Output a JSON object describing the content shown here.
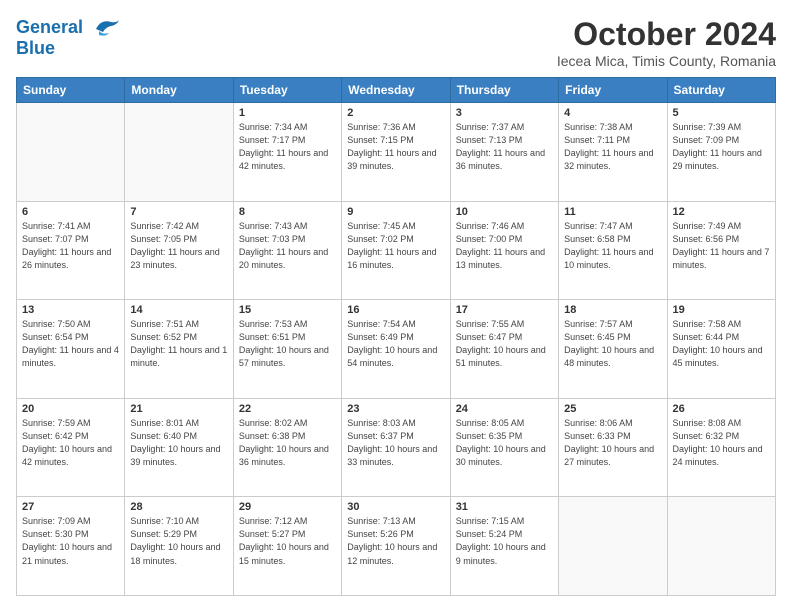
{
  "header": {
    "logo_line1": "General",
    "logo_line2": "Blue",
    "main_title": "October 2024",
    "subtitle": "Iecea Mica, Timis County, Romania"
  },
  "days_of_week": [
    "Sunday",
    "Monday",
    "Tuesday",
    "Wednesday",
    "Thursday",
    "Friday",
    "Saturday"
  ],
  "weeks": [
    [
      {
        "day": "",
        "detail": ""
      },
      {
        "day": "",
        "detail": ""
      },
      {
        "day": "1",
        "detail": "Sunrise: 7:34 AM\nSunset: 7:17 PM\nDaylight: 11 hours and 42 minutes."
      },
      {
        "day": "2",
        "detail": "Sunrise: 7:36 AM\nSunset: 7:15 PM\nDaylight: 11 hours and 39 minutes."
      },
      {
        "day": "3",
        "detail": "Sunrise: 7:37 AM\nSunset: 7:13 PM\nDaylight: 11 hours and 36 minutes."
      },
      {
        "day": "4",
        "detail": "Sunrise: 7:38 AM\nSunset: 7:11 PM\nDaylight: 11 hours and 32 minutes."
      },
      {
        "day": "5",
        "detail": "Sunrise: 7:39 AM\nSunset: 7:09 PM\nDaylight: 11 hours and 29 minutes."
      }
    ],
    [
      {
        "day": "6",
        "detail": "Sunrise: 7:41 AM\nSunset: 7:07 PM\nDaylight: 11 hours and 26 minutes."
      },
      {
        "day": "7",
        "detail": "Sunrise: 7:42 AM\nSunset: 7:05 PM\nDaylight: 11 hours and 23 minutes."
      },
      {
        "day": "8",
        "detail": "Sunrise: 7:43 AM\nSunset: 7:03 PM\nDaylight: 11 hours and 20 minutes."
      },
      {
        "day": "9",
        "detail": "Sunrise: 7:45 AM\nSunset: 7:02 PM\nDaylight: 11 hours and 16 minutes."
      },
      {
        "day": "10",
        "detail": "Sunrise: 7:46 AM\nSunset: 7:00 PM\nDaylight: 11 hours and 13 minutes."
      },
      {
        "day": "11",
        "detail": "Sunrise: 7:47 AM\nSunset: 6:58 PM\nDaylight: 11 hours and 10 minutes."
      },
      {
        "day": "12",
        "detail": "Sunrise: 7:49 AM\nSunset: 6:56 PM\nDaylight: 11 hours and 7 minutes."
      }
    ],
    [
      {
        "day": "13",
        "detail": "Sunrise: 7:50 AM\nSunset: 6:54 PM\nDaylight: 11 hours and 4 minutes."
      },
      {
        "day": "14",
        "detail": "Sunrise: 7:51 AM\nSunset: 6:52 PM\nDaylight: 11 hours and 1 minute."
      },
      {
        "day": "15",
        "detail": "Sunrise: 7:53 AM\nSunset: 6:51 PM\nDaylight: 10 hours and 57 minutes."
      },
      {
        "day": "16",
        "detail": "Sunrise: 7:54 AM\nSunset: 6:49 PM\nDaylight: 10 hours and 54 minutes."
      },
      {
        "day": "17",
        "detail": "Sunrise: 7:55 AM\nSunset: 6:47 PM\nDaylight: 10 hours and 51 minutes."
      },
      {
        "day": "18",
        "detail": "Sunrise: 7:57 AM\nSunset: 6:45 PM\nDaylight: 10 hours and 48 minutes."
      },
      {
        "day": "19",
        "detail": "Sunrise: 7:58 AM\nSunset: 6:44 PM\nDaylight: 10 hours and 45 minutes."
      }
    ],
    [
      {
        "day": "20",
        "detail": "Sunrise: 7:59 AM\nSunset: 6:42 PM\nDaylight: 10 hours and 42 minutes."
      },
      {
        "day": "21",
        "detail": "Sunrise: 8:01 AM\nSunset: 6:40 PM\nDaylight: 10 hours and 39 minutes."
      },
      {
        "day": "22",
        "detail": "Sunrise: 8:02 AM\nSunset: 6:38 PM\nDaylight: 10 hours and 36 minutes."
      },
      {
        "day": "23",
        "detail": "Sunrise: 8:03 AM\nSunset: 6:37 PM\nDaylight: 10 hours and 33 minutes."
      },
      {
        "day": "24",
        "detail": "Sunrise: 8:05 AM\nSunset: 6:35 PM\nDaylight: 10 hours and 30 minutes."
      },
      {
        "day": "25",
        "detail": "Sunrise: 8:06 AM\nSunset: 6:33 PM\nDaylight: 10 hours and 27 minutes."
      },
      {
        "day": "26",
        "detail": "Sunrise: 8:08 AM\nSunset: 6:32 PM\nDaylight: 10 hours and 24 minutes."
      }
    ],
    [
      {
        "day": "27",
        "detail": "Sunrise: 7:09 AM\nSunset: 5:30 PM\nDaylight: 10 hours and 21 minutes."
      },
      {
        "day": "28",
        "detail": "Sunrise: 7:10 AM\nSunset: 5:29 PM\nDaylight: 10 hours and 18 minutes."
      },
      {
        "day": "29",
        "detail": "Sunrise: 7:12 AM\nSunset: 5:27 PM\nDaylight: 10 hours and 15 minutes."
      },
      {
        "day": "30",
        "detail": "Sunrise: 7:13 AM\nSunset: 5:26 PM\nDaylight: 10 hours and 12 minutes."
      },
      {
        "day": "31",
        "detail": "Sunrise: 7:15 AM\nSunset: 5:24 PM\nDaylight: 10 hours and 9 minutes."
      },
      {
        "day": "",
        "detail": ""
      },
      {
        "day": "",
        "detail": ""
      }
    ]
  ]
}
